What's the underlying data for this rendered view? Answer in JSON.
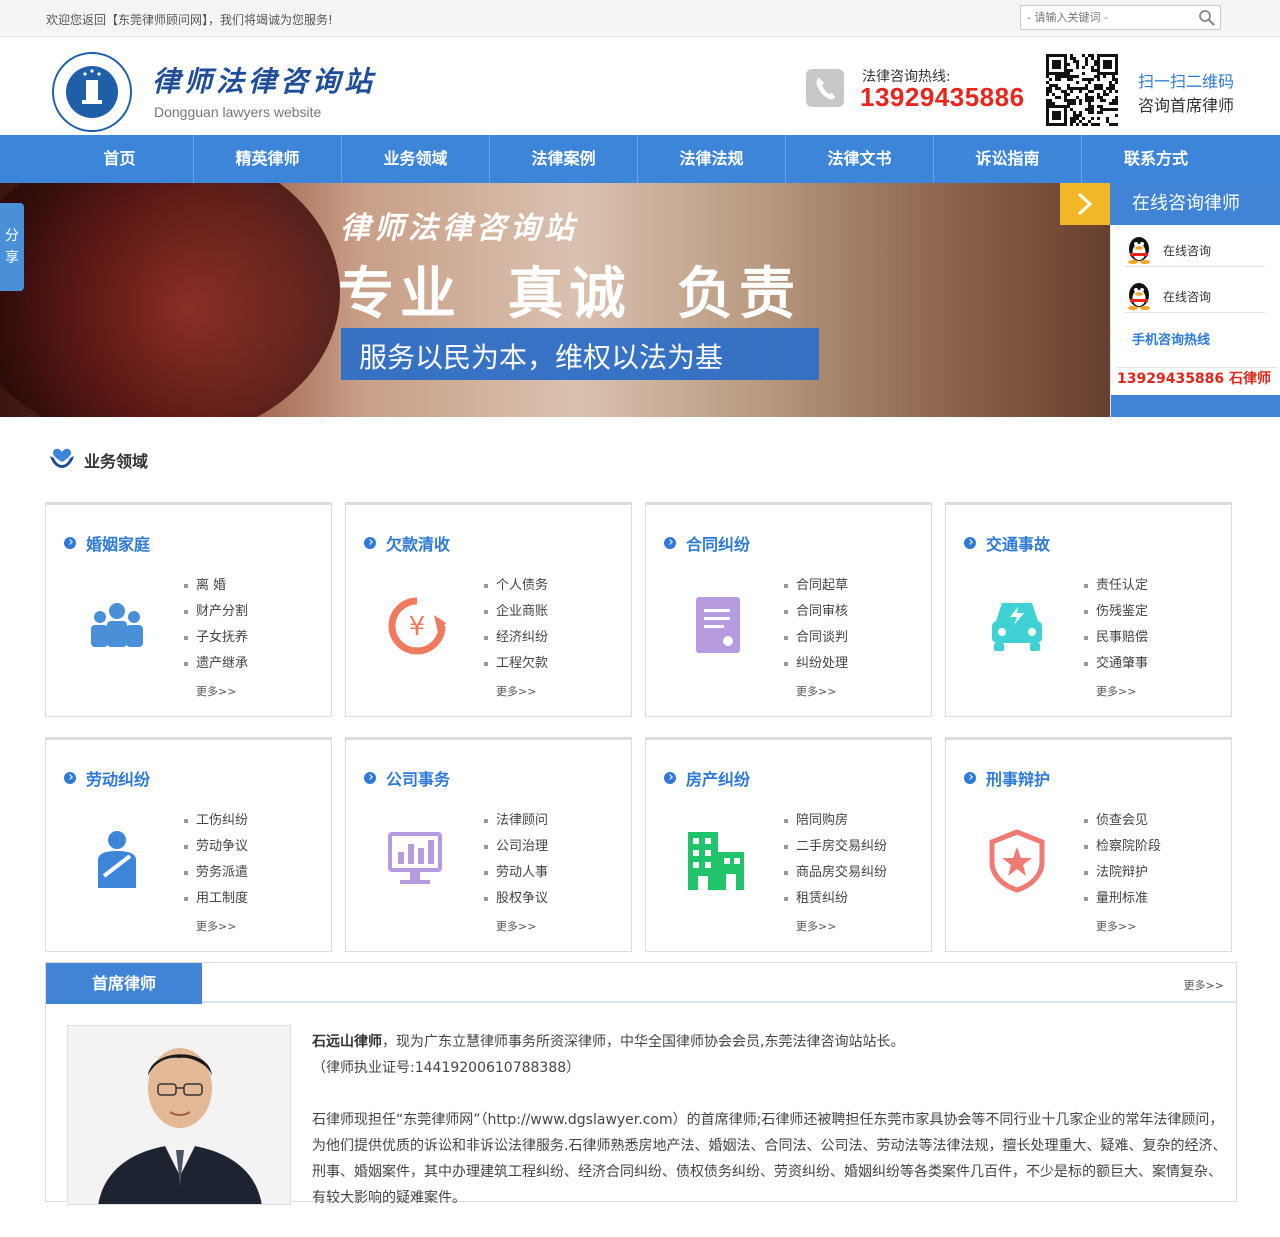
{
  "topbar": {
    "welcome": "欢迎您返回【东莞律师顾问网】，我们将竭诚为您服务!",
    "search_placeholder": "- 请输入关键词 -"
  },
  "header": {
    "site_title": "律师法律咨询站",
    "site_subtitle": "Dongguan lawyers website",
    "hotline_label": "法律咨询热线:",
    "hotline_number": "13929435886",
    "qr_line1": "扫一扫二维码",
    "qr_line2": "咨询首席律师"
  },
  "nav": {
    "items": [
      "首页",
      "精英律师",
      "业务领域",
      "法律案例",
      "法律法规",
      "法律文书",
      "诉讼指南",
      "联系方式"
    ]
  },
  "banner": {
    "script_title": "律师法律咨询站",
    "headline": "专业  真诚  负责",
    "slogan": "服务以民为本，维权以法为基"
  },
  "share": {
    "label": "分享"
  },
  "consult": {
    "title": "在线咨询律师",
    "qq1": "在线咨询",
    "qq2": "在线咨询",
    "mobile_label": "手机咨询热线",
    "mobile_number": "13929435886 石律师"
  },
  "business": {
    "section_title": "业务领域",
    "more_label": "更多>>",
    "cards": [
      {
        "title": "婚姻家庭",
        "icon": "family-icon",
        "items": [
          "离 婚",
          "财产分割",
          "子女抚养",
          "遗产继承"
        ]
      },
      {
        "title": "欠款清收",
        "icon": "debt-icon",
        "items": [
          "个人债务",
          "企业商账",
          "经济纠纷",
          "工程欠款"
        ]
      },
      {
        "title": "合同纠纷",
        "icon": "contract-icon",
        "items": [
          "合同起草",
          "合同审核",
          "合同谈判",
          "纠纷处理"
        ]
      },
      {
        "title": "交通事故",
        "icon": "car-icon",
        "items": [
          "责任认定",
          "伤残鉴定",
          "民事赔偿",
          "交通肇事"
        ]
      },
      {
        "title": "劳动纠纷",
        "icon": "worker-icon",
        "items": [
          "工伤纠纷",
          "劳动争议",
          "劳务派遣",
          "用工制度"
        ]
      },
      {
        "title": "公司事务",
        "icon": "company-icon",
        "items": [
          "法律顾问",
          "公司治理",
          "劳动人事",
          "股权争议"
        ]
      },
      {
        "title": "房产纠纷",
        "icon": "building-icon",
        "items": [
          "陪同购房",
          "二手房交易纠纷",
          "商品房交易纠纷",
          "租赁纠纷"
        ]
      },
      {
        "title": "刑事辩护",
        "icon": "badge-icon",
        "items": [
          "侦查会见",
          "检察院阶段",
          "法院辩护",
          "量刑标准"
        ]
      }
    ]
  },
  "lawyer": {
    "tab_label": "首席律师",
    "more_label": "更多>>",
    "name": "石远山律师",
    "intro": "，现为广东立慧律师事务所资深律师，中华全国律师协会会员,东莞法律咨询站站长。",
    "license": "（律师执业证号:14419200610788388）",
    "bio": "石律师现担任“东莞律师网”（http://www.dgslawyer.com）的首席律师;石律师还被聘担任东莞市家具协会等不同行业十几家企业的常年法律顾问，为他们提供优质的诉讼和非诉讼法律服务.石律师熟悉房地产法、婚姻法、合同法、公司法、劳动法等法律法规，擅长处理重大、疑难、复杂的经济、刑事、婚姻案件，其中办理建筑工程纠纷、经济合同纠纷、债权债务纠纷、劳资纠纷、婚姻纠纷等各类案件几百件，不少是标的额巨大、案情复杂、有较大影响的疑难案件。"
  },
  "colors": {
    "brand_blue": "#3d85d8",
    "hotline_red": "#e8261e",
    "accent_yellow": "#f1b827"
  }
}
